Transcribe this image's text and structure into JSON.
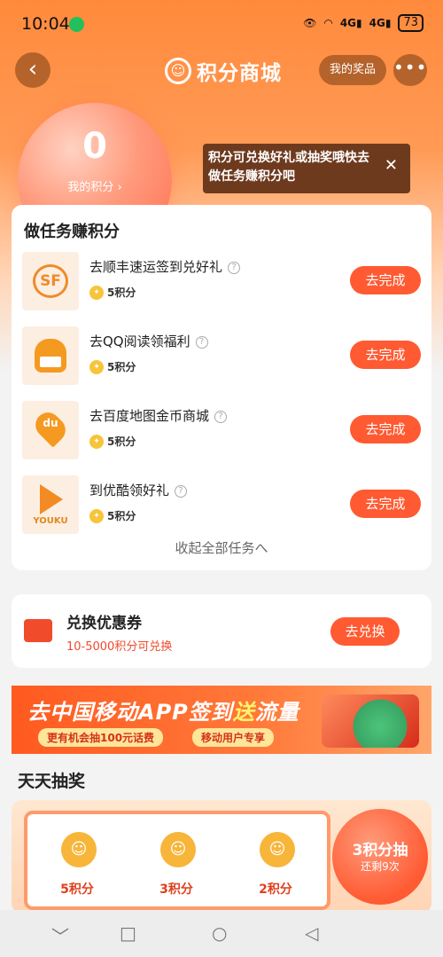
{
  "status_bar": {
    "time": "10:04",
    "network_1": "4G",
    "network_2": "4G",
    "battery": "73"
  },
  "header": {
    "title": "积分商城",
    "my_prizes": "我的奖品",
    "more": "•••"
  },
  "points": {
    "value": "0",
    "label": "我的积分 ›"
  },
  "tooltip": {
    "text": "积分可兑换好礼或抽奖哦快去做任务赚积分吧"
  },
  "tasks": {
    "title": "做任务赚积分",
    "items": [
      {
        "title": "去顺丰速运签到兑好礼",
        "points": "5积分",
        "button": "去完成",
        "icon_text": "SF"
      },
      {
        "title": "去QQ阅读领福利",
        "points": "5积分",
        "button": "去完成",
        "icon_text": ""
      },
      {
        "title": "去百度地图金币商城",
        "points": "5积分",
        "button": "去完成",
        "icon_text": "du"
      },
      {
        "title": "到优酷领好礼",
        "points": "5积分",
        "button": "去完成",
        "icon_text": "YOUKU"
      }
    ],
    "collapse": "收起全部任务へ"
  },
  "coupon": {
    "title": "兑换优惠券",
    "subtitle": "10-5000积分可兑换",
    "button": "去兑换"
  },
  "banner": {
    "main_prefix": "去中国移动APP签到",
    "main_highlight": "送",
    "main_suffix": "流量",
    "tag1": "更有机会抽100元话费",
    "tag2": "移动用户专享"
  },
  "lottery": {
    "title": "天天抽奖",
    "prizes": [
      {
        "label": "5积分"
      },
      {
        "label": "3积分"
      },
      {
        "label": "2积分"
      }
    ],
    "draw_main": "3积分抽",
    "draw_sub": "还剩9次"
  },
  "nav": {
    "back": "﹀",
    "home": "□",
    "recent": "○",
    "return": "◁"
  }
}
